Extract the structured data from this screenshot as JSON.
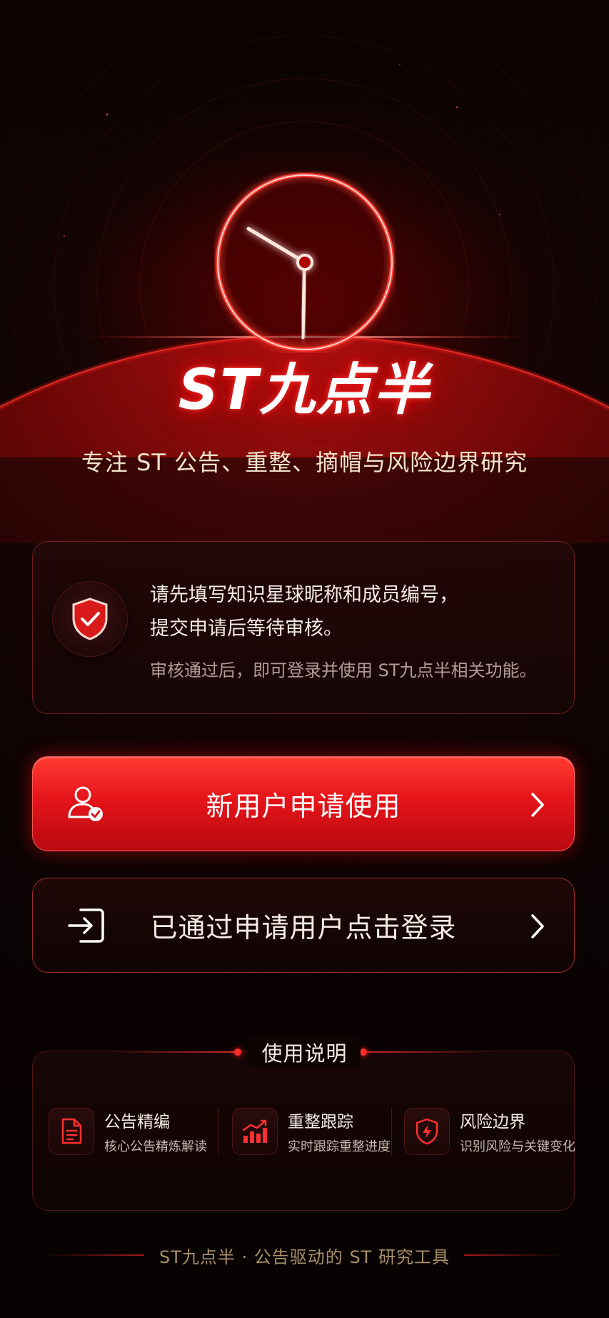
{
  "app": {
    "brand_title": "ST九点半",
    "tagline": "专注 ST 公告、重整、摘帽与风险边界研究"
  },
  "info_card": {
    "icon": "shield-check-icon",
    "line1": "请先填写知识星球昵称和成员编号，",
    "line2": "提交申请后等待审核。",
    "note": "审核通过后，即可登录并使用 ST九点半相关功能。"
  },
  "buttons": {
    "apply": {
      "label": "新用户申请使用",
      "icon": "user-check-icon",
      "chevron": "chevron-right-icon"
    },
    "login": {
      "label": "已通过申请用户点击登录",
      "icon": "login-arrow-icon",
      "chevron": "chevron-right-icon"
    }
  },
  "guide": {
    "title": "使用说明",
    "features": [
      {
        "title": "公告精编",
        "desc": "核心公告精炼解读",
        "icon": "document-icon"
      },
      {
        "title": "重整跟踪",
        "desc": "实时跟踪重整进度",
        "icon": "bar-chart-trend-icon"
      },
      {
        "title": "风险边界",
        "desc": "识别风险与关键变化",
        "icon": "shield-lightning-icon"
      }
    ]
  },
  "footer": {
    "text": "ST九点半 · 公告驱动的 ST 研究工具"
  },
  "colors": {
    "accent": "#e5141a",
    "background": "#0a0303",
    "gold_text": "#f1e2c8"
  }
}
